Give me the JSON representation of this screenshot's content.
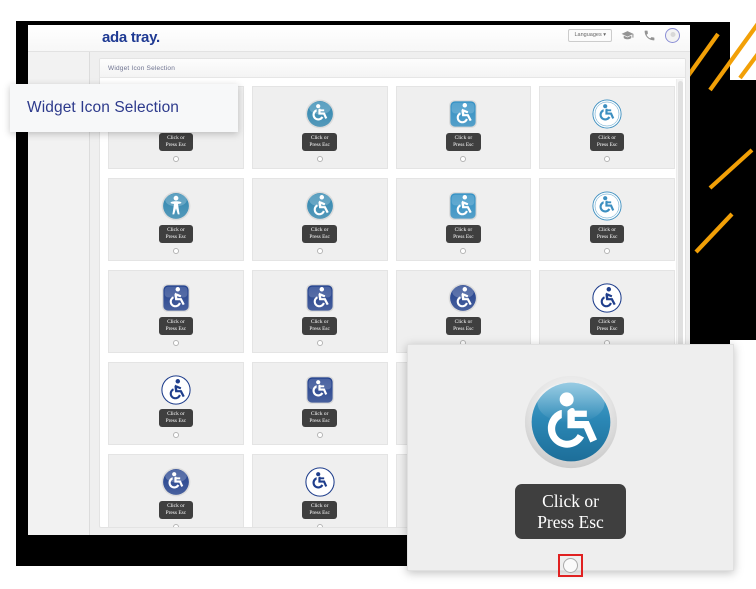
{
  "window": {
    "brand": "ada tray.",
    "languages_button": "Languages ▾",
    "icons": {
      "graduation": "graduation-cap-icon",
      "phone": "phone-icon",
      "avatar": "user-avatar"
    }
  },
  "panel": {
    "header": "Widget Icon Selection"
  },
  "callout": {
    "title": "Widget Icon Selection"
  },
  "tooltip": {
    "label": "Click or\nPress Esc"
  },
  "zoom_card": {
    "tooltip": "Click or\nPress Esc",
    "icon_name": "blue-glossy-wheelchair-icon",
    "radio_focused": true
  },
  "colors": {
    "brand_navy": "#1f3a93",
    "callout_text": "#2d3a8c",
    "accent_orange": "#f2a007",
    "tooltip_bg": "#3f3f3f",
    "cell_bg": "#efefef",
    "focus_red": "#e02020",
    "icon_blue": "#2b87b5",
    "icon_navy": "#1f3e8c"
  },
  "grid": {
    "columns": 4,
    "cells": [
      {
        "id": 1,
        "icon": "blue-circle-wheelchair-icon",
        "style": "circle",
        "color": "#2e86b0"
      },
      {
        "id": 2,
        "icon": "blue-circle-wheelchair-icon",
        "style": "circle",
        "color": "#2e86b0"
      },
      {
        "id": 3,
        "icon": "blue-square-accessible-icon",
        "style": "square",
        "color": "#2f8fc4"
      },
      {
        "id": 4,
        "icon": "blue-outline-circle-wheelchair-icon",
        "style": "outline",
        "color": "#3d8fc0"
      },
      {
        "id": 5,
        "icon": "blue-circle-person-icon",
        "style": "circle",
        "color": "#2e86b0"
      },
      {
        "id": 6,
        "icon": "blue-circle-accessible-icon",
        "style": "circle",
        "color": "#2e86b0"
      },
      {
        "id": 7,
        "icon": "blue-square-accessible-icon",
        "style": "square",
        "color": "#2f8fc4"
      },
      {
        "id": 8,
        "icon": "blue-outline-circle-wheelchair-icon",
        "style": "outline",
        "color": "#3d8fc0"
      },
      {
        "id": 9,
        "icon": "navy-square-accessible-icon",
        "style": "square",
        "color": "#1f3e8c"
      },
      {
        "id": 10,
        "icon": "navy-square-accessible-icon",
        "style": "square",
        "color": "#1f3e8c"
      },
      {
        "id": 11,
        "icon": "navy-circle-accessible-icon",
        "style": "circle",
        "color": "#1f3e8c"
      },
      {
        "id": 12,
        "icon": "navy-ring-accessible-icon",
        "style": "outline-navy",
        "color": "#1f3e8c"
      },
      {
        "id": 13,
        "icon": "navy-outline-accessible-icon",
        "style": "outline-navy",
        "color": "#1f3e8c"
      },
      {
        "id": 14,
        "icon": "navy-square-wheelchair-icon",
        "style": "square",
        "color": "#1f3e8c"
      },
      {
        "id": 15,
        "icon": "navy-square-wheelchair-icon",
        "style": "square",
        "color": "#1f3e8c"
      },
      {
        "id": 16,
        "icon": "navy-circle-wheelchair-icon",
        "style": "circle",
        "color": "#1f3e8c"
      },
      {
        "id": 17,
        "icon": "navy-circle-wheelchair-icon",
        "style": "circle",
        "color": "#1f3e8c"
      },
      {
        "id": 18,
        "icon": "navy-outline-wheelchair-icon",
        "style": "outline-navy",
        "color": "#1f3e8c"
      },
      {
        "id": 19,
        "icon": "navy-circle-wheelchair-icon",
        "style": "circle",
        "color": "#1f3e8c"
      },
      {
        "id": 20,
        "icon": "navy-square-wheelchair-icon",
        "style": "square",
        "color": "#1f3e8c"
      }
    ]
  },
  "decoration": {
    "stripe_color": "#f2a007",
    "stripe_count_top": 4,
    "stripe_count_bottom": 2
  }
}
